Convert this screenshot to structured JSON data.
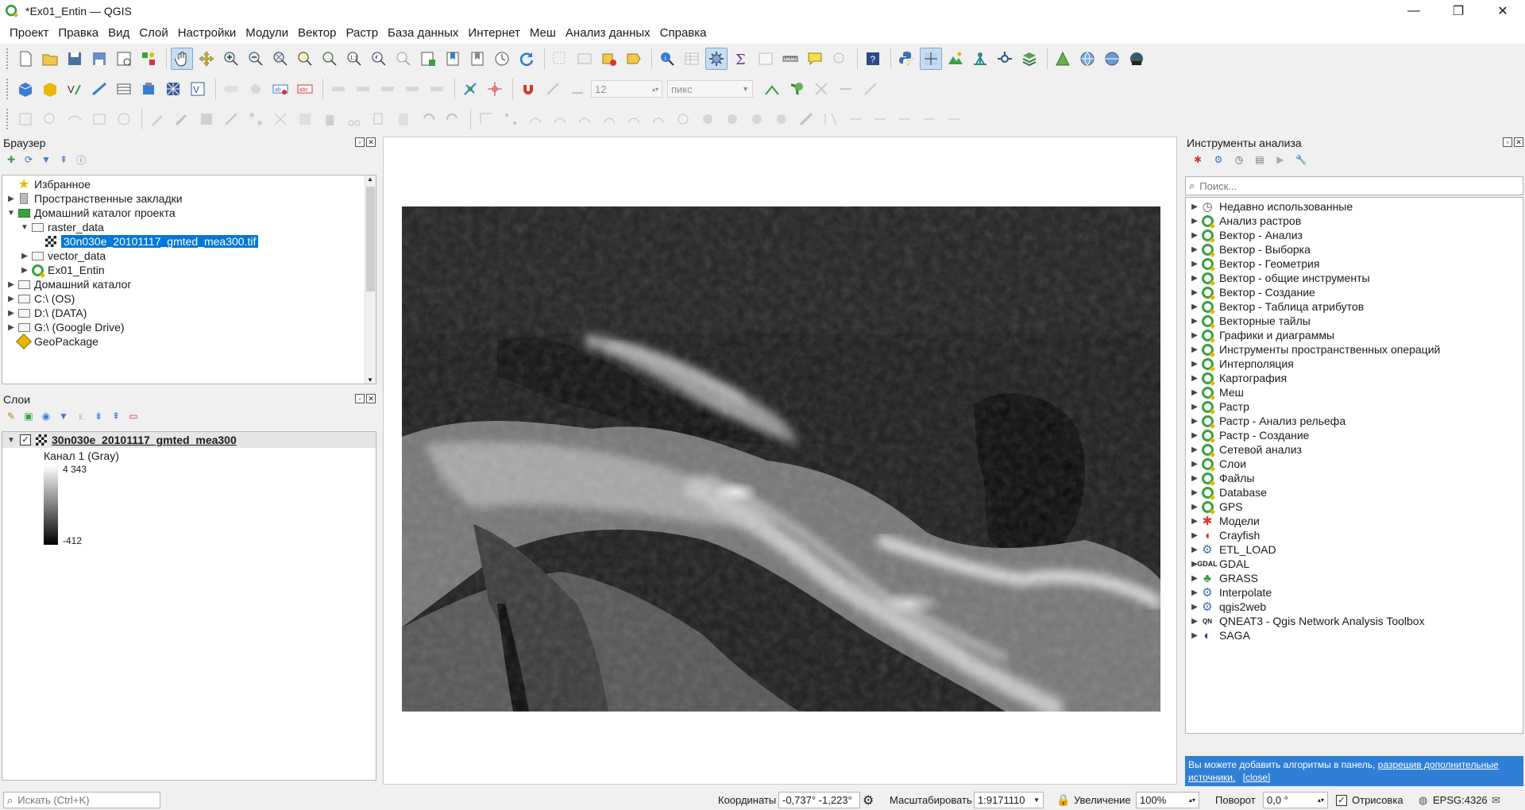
{
  "window": {
    "title": "*Ex01_Entin — QGIS",
    "minimize": "—",
    "maximize": "❐",
    "close": "✕"
  },
  "menu": [
    "Проект",
    "Правка",
    "Вид",
    "Слой",
    "Настройки",
    "Модули",
    "Вектор",
    "Растр",
    "База данных",
    "Интернет",
    "Меш",
    "Анализ данных",
    "Справка"
  ],
  "toolbar2": {
    "size_value": "12",
    "unit_value": "пикс"
  },
  "browser": {
    "title": "Браузер",
    "items": [
      {
        "label": "Избранное",
        "indent": 0,
        "arrow": "",
        "icon": "star"
      },
      {
        "label": "Пространственные закладки",
        "indent": 0,
        "arrow": "▶",
        "icon": "bookmark"
      },
      {
        "label": "Домашний каталог проекта",
        "indent": 0,
        "arrow": "▼",
        "icon": "home-folder"
      },
      {
        "label": "raster_data",
        "indent": 1,
        "arrow": "▼",
        "icon": "folder"
      },
      {
        "label": "30n030e_20101117_gmted_mea300.tif",
        "indent": 2,
        "arrow": "",
        "icon": "raster",
        "selected": true
      },
      {
        "label": "vector_data",
        "indent": 1,
        "arrow": "▶",
        "icon": "folder"
      },
      {
        "label": "Ex01_Entin",
        "indent": 1,
        "arrow": "▶",
        "icon": "qgis"
      },
      {
        "label": "Домашний каталог",
        "indent": 0,
        "arrow": "▶",
        "icon": "folder"
      },
      {
        "label": "C:\\ (OS)",
        "indent": 0,
        "arrow": "▶",
        "icon": "folder"
      },
      {
        "label": "D:\\ (DATA)",
        "indent": 0,
        "arrow": "▶",
        "icon": "folder"
      },
      {
        "label": "G:\\ (Google Drive)",
        "indent": 0,
        "arrow": "▶",
        "icon": "folder"
      },
      {
        "label": "GeoPackage",
        "indent": 0,
        "arrow": "",
        "icon": "geopackage"
      }
    ]
  },
  "layers": {
    "title": "Слои",
    "layer_name": "30n030e_20101117_gmted_mea300",
    "band_label": "Канал 1 (Gray)",
    "max_value": "4 343",
    "min_value": "-412"
  },
  "processing": {
    "title": "Инструменты анализа",
    "search_placeholder": "Поиск...",
    "items": [
      {
        "label": "Недавно использованные",
        "icon": "clock"
      },
      {
        "label": "Анализ растров",
        "icon": "qgis"
      },
      {
        "label": "Вектор - Анализ",
        "icon": "qgis"
      },
      {
        "label": "Вектор - Выборка",
        "icon": "qgis"
      },
      {
        "label": "Вектор - Геометрия",
        "icon": "qgis"
      },
      {
        "label": "Вектор - общие инструменты",
        "icon": "qgis"
      },
      {
        "label": "Вектор - Создание",
        "icon": "qgis"
      },
      {
        "label": "Вектор - Таблица атрибутов",
        "icon": "qgis"
      },
      {
        "label": "Векторные тайлы",
        "icon": "qgis"
      },
      {
        "label": "Графики и диаграммы",
        "icon": "qgis"
      },
      {
        "label": "Инструменты пространственных операций",
        "icon": "qgis"
      },
      {
        "label": "Интерполяция",
        "icon": "qgis"
      },
      {
        "label": "Картография",
        "icon": "qgis"
      },
      {
        "label": "Меш",
        "icon": "qgis"
      },
      {
        "label": "Растр",
        "icon": "qgis"
      },
      {
        "label": "Растр - Анализ рельефа",
        "icon": "qgis"
      },
      {
        "label": "Растр - Создание",
        "icon": "qgis"
      },
      {
        "label": "Сетевой анализ",
        "icon": "qgis"
      },
      {
        "label": "Слои",
        "icon": "qgis"
      },
      {
        "label": "Файлы",
        "icon": "qgis"
      },
      {
        "label": "Database",
        "icon": "qgis"
      },
      {
        "label": "GPS",
        "icon": "qgis"
      },
      {
        "label": "Модели",
        "icon": "models"
      },
      {
        "label": "Crayfish",
        "icon": "crayfish"
      },
      {
        "label": "ETL_LOAD",
        "icon": "gear"
      },
      {
        "label": "GDAL",
        "icon": "gdal"
      },
      {
        "label": "GRASS",
        "icon": "grass"
      },
      {
        "label": "Interpolate",
        "icon": "gear"
      },
      {
        "label": "qgis2web",
        "icon": "gear"
      },
      {
        "label": "QNEAT3 - Qgis Network Analysis Toolbox",
        "icon": "qneat"
      },
      {
        "label": "SAGA",
        "icon": "saga"
      }
    ],
    "notice_text": "Вы можете добавить алгоритмы в панель,",
    "notice_link": "разрешив дополнительные источники.",
    "notice_close": "[close]"
  },
  "status": {
    "search_placeholder": "Искать (Ctrl+K)",
    "coords_label": "Координаты",
    "coords_value": "-0,737° -1,223°",
    "scale_label": "Масштабировать",
    "scale_value": "1:9171110",
    "zoom_label": "Увеличение",
    "zoom_value": "100%",
    "rotation_label": "Поворот",
    "rotation_value": "0,0 °",
    "render_label": "Отрисовка",
    "crs_value": "EPSG:4326"
  },
  "colors": {
    "selection": "#0078d7",
    "notice_bg": "#2f7fd6",
    "qgis_green": "#3aa040"
  }
}
